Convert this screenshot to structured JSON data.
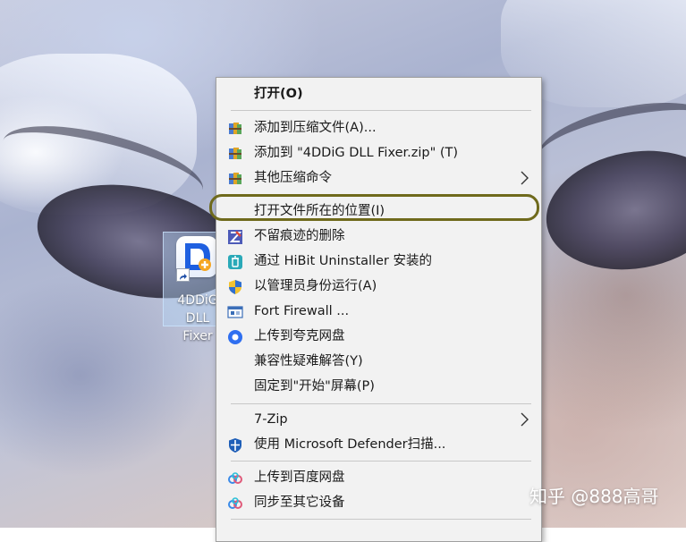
{
  "desktop": {
    "icon_label": "4DDiG DLL\nFixer"
  },
  "context_menu": {
    "items": [
      {
        "label": "打开(O)",
        "icon": "none",
        "bold": true
      },
      {
        "label": "添加到压缩文件(A)...",
        "icon": "winrar-archive-icon"
      },
      {
        "label": "添加到 \"4DDiG DLL Fixer.zip\" (T)",
        "icon": "winrar-archive-icon"
      },
      {
        "label": "其他压缩命令",
        "icon": "winrar-archive-icon",
        "submenu": true
      },
      {
        "label": "打开文件所在的位置(I)",
        "icon": "none"
      },
      {
        "label": "不留痕迹的删除",
        "icon": "erase-icon"
      },
      {
        "label": "通过 HiBit Uninstaller 安装的",
        "icon": "hibit-uninstaller-icon"
      },
      {
        "label": "以管理员身份运行(A)",
        "icon": "uac-shield-icon"
      },
      {
        "label": "Fort Firewall ...",
        "icon": "firewall-icon"
      },
      {
        "label": "上传到夸克网盘",
        "icon": "quark-cloud-icon"
      },
      {
        "label": "兼容性疑难解答(Y)",
        "icon": "none"
      },
      {
        "label": "固定到\"开始\"屏幕(P)",
        "icon": "none"
      },
      {
        "label": "7-Zip",
        "icon": "none",
        "submenu": true
      },
      {
        "label": "使用 Microsoft Defender扫描...",
        "icon": "defender-shield-icon"
      },
      {
        "label": "上传到百度网盘",
        "icon": "baidu-cloud-icon"
      },
      {
        "label": "同步至其它设备",
        "icon": "baidu-cloud-icon"
      }
    ],
    "highlighted_item": "打开文件所在的位置(I)"
  },
  "watermark": {
    "text": "知乎 @888高哥"
  },
  "colors": {
    "menu_background": "#f2f2f2",
    "highlight_ring": "#6f6a1c",
    "icon_selection": "#b4d2f5"
  }
}
